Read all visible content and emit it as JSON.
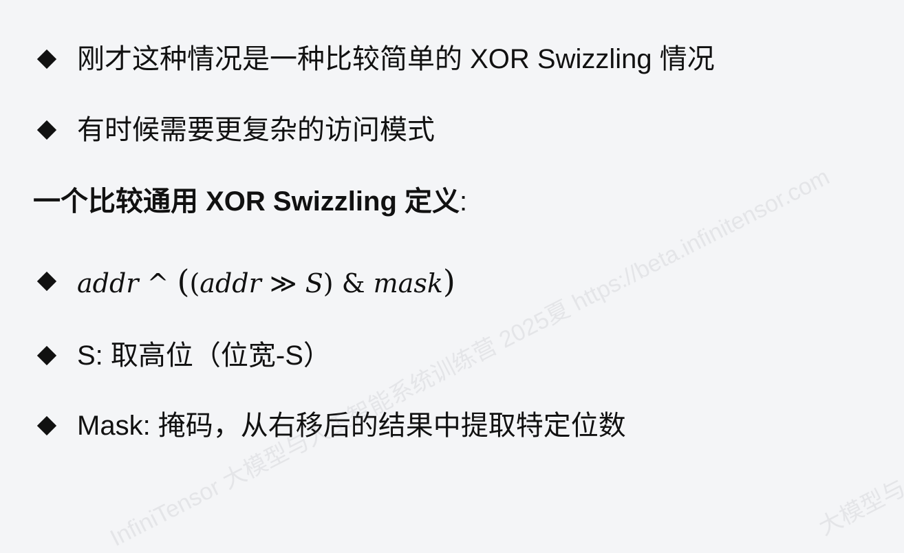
{
  "bullets": [
    {
      "text": "刚才这种情况是一种比较简单的 XOR Swizzling 情况"
    },
    {
      "text": "有时候需要更复杂的访问模式"
    }
  ],
  "heading": {
    "text": "一个比较通用 XOR Swizzling 定义",
    "colon": ":"
  },
  "formula": {
    "addr1": "addr",
    "caret": "^",
    "open_outer": "(",
    "open_inner": "(",
    "addr2": "addr",
    "shift": "≫",
    "s": "S",
    "close_inner": ")",
    "amp": "&",
    "mask": "mask",
    "close_outer": ")"
  },
  "definitions": [
    {
      "text": "S: 取高位（位宽-S）"
    },
    {
      "text": "Mask: 掩码，从右移后的结果中提取特定位数"
    }
  ],
  "watermark": {
    "main": "InfiniTensor 大模型与人工智能系统训练营 2025夏 https://beta.infinitensor.com",
    "fragment": "大模型与"
  }
}
